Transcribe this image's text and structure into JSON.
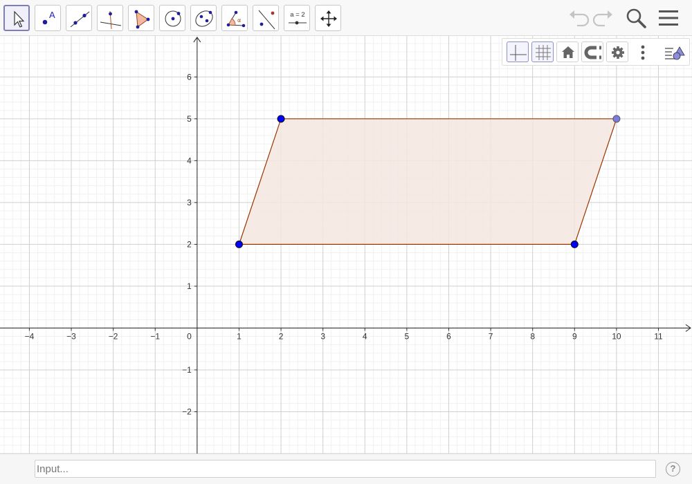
{
  "toolbar": {
    "tools": [
      {
        "name": "move-tool",
        "icon": "move-cursor-icon",
        "active": true
      },
      {
        "name": "point-tool",
        "icon": "point-icon",
        "label": "A"
      },
      {
        "name": "line-tool",
        "icon": "line-through-two-points-icon"
      },
      {
        "name": "perpendicular-line-tool",
        "icon": "perpendicular-line-icon"
      },
      {
        "name": "polygon-tool",
        "icon": "polygon-icon"
      },
      {
        "name": "circle-center-point-tool",
        "icon": "circle-center-point-icon"
      },
      {
        "name": "conic-tool",
        "icon": "ellipse-icon"
      },
      {
        "name": "angle-tool",
        "icon": "angle-icon",
        "label": "α"
      },
      {
        "name": "reflect-tool",
        "icon": "reflect-about-line-icon"
      },
      {
        "name": "slider-tool",
        "icon": "slider-icon",
        "label": "a = 2"
      },
      {
        "name": "move-graphics-view-tool",
        "icon": "move-graphics-view-icon"
      }
    ],
    "right": [
      "undo-icon",
      "redo-icon",
      "search-icon",
      "menu-icon"
    ]
  },
  "style_bar": {
    "buttons": [
      "axes-toggle-icon",
      "grid-toggle-icon",
      "home-icon",
      "magnet-icon",
      "gear-icon",
      "more-vertical-icon",
      "graphics-view-icon"
    ],
    "axes_on": true,
    "grid_on": true
  },
  "graph": {
    "x_range": [
      -4.7,
      11.8
    ],
    "y_range": [
      -3,
      6.98
    ],
    "x_ticks": [
      "−4",
      "−3",
      "−2",
      "−1",
      "1",
      "2",
      "3",
      "4",
      "5",
      "6",
      "7",
      "8",
      "9",
      "10",
      "11"
    ],
    "y_ticks": [
      "6",
      "5",
      "4",
      "3",
      "2",
      "1",
      "−1",
      "−2"
    ],
    "origin_label": "0",
    "polygon": {
      "vertices": [
        [
          1,
          2
        ],
        [
          9,
          2
        ],
        [
          10,
          5
        ],
        [
          2,
          5
        ]
      ],
      "stroke": "#993300",
      "fill": "#f5e6e0",
      "point_color": "#0000ff",
      "highlight_point_color": "#7b7be0"
    }
  },
  "input_bar": {
    "placeholder": "Input...",
    "value": "",
    "help_label": "?"
  }
}
